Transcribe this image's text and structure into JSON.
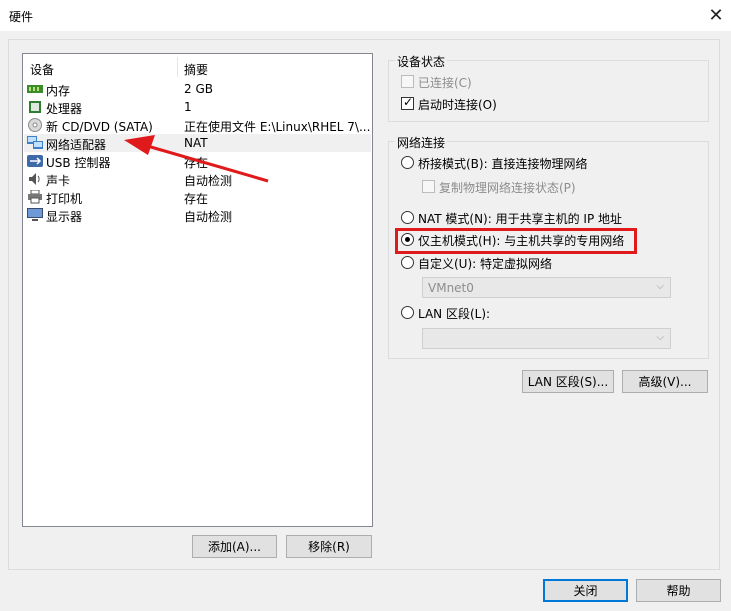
{
  "window": {
    "title": "硬件"
  },
  "device_list": {
    "col_device": "设备",
    "col_summary": "摘要",
    "rows": [
      {
        "name": "内存",
        "summary": "2 GB",
        "icon": "memory-icon"
      },
      {
        "name": "处理器",
        "summary": "1",
        "icon": "cpu-icon"
      },
      {
        "name": "新 CD/DVD (SATA)",
        "summary": "正在使用文件 E:\\Linux\\RHEL 7\\...",
        "icon": "cd-icon"
      },
      {
        "name": "网络适配器",
        "summary": "NAT",
        "icon": "network-adapter-icon"
      },
      {
        "name": "USB 控制器",
        "summary": "存在",
        "icon": "usb-icon"
      },
      {
        "name": "声卡",
        "summary": "自动检测",
        "icon": "sound-icon"
      },
      {
        "name": "打印机",
        "summary": "存在",
        "icon": "printer-icon"
      },
      {
        "name": "显示器",
        "summary": "自动检测",
        "icon": "display-icon"
      }
    ],
    "selected_index": 3
  },
  "buttons": {
    "add": "添加(A)...",
    "remove": "移除(R)",
    "lan_segments": "LAN 区段(S)...",
    "advanced": "高级(V)...",
    "close": "关闭",
    "help": "帮助"
  },
  "device_status": {
    "title": "设备状态",
    "connected": {
      "label": "已连接(C)",
      "checked": false,
      "enabled": false
    },
    "connect_at_power_on": {
      "label": "启动时连接(O)",
      "checked": true,
      "enabled": true
    }
  },
  "network_connection": {
    "title": "网络连接",
    "bridged": "桥接模式(B): 直接连接物理网络",
    "replicate": "复制物理网络连接状态(P)",
    "nat": "NAT 模式(N): 用于共享主机的 IP 地址",
    "host_only": "仅主机模式(H): 与主机共享的专用网络",
    "custom": "自定义(U): 特定虚拟网络",
    "custom_value": "VMnet0",
    "lan_segment": "LAN 区段(L):",
    "lan_segment_value": "",
    "selected": "host_only"
  },
  "colors": {
    "highlight": "#e0191b",
    "arrow": "#e0191b",
    "default_button_border": "#0078d7"
  }
}
